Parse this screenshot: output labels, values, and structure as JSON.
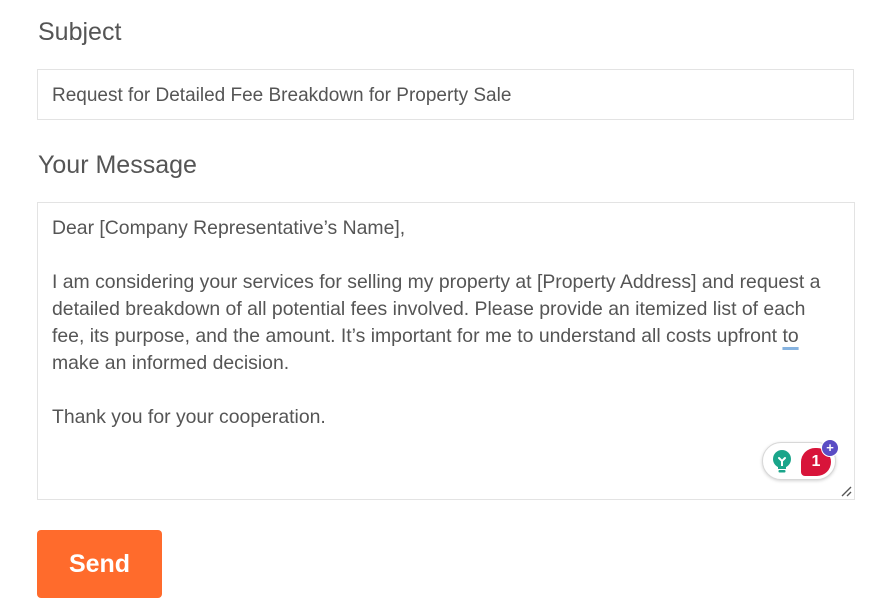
{
  "form": {
    "subject_label": "Subject",
    "subject_value": "Request for Detailed Fee Breakdown for Property Sale",
    "message_label": "Your Message",
    "message": {
      "greeting": "Dear [Company Representative’s Name],",
      "body_before_underline": "I am considering your services for selling my property at [Property Address] and request a detailed breakdown of all potential fees involved. Please provide an itemized list of each fee, its purpose, and the amount. It’s important for me to understand all costs upfront ",
      "body_underlined_word": "to",
      "body_after_underline": " make an informed decision.",
      "closing": "Thank you for your cooperation."
    },
    "send_label": "Send"
  },
  "grammarly": {
    "alert_count": "1",
    "plus_symbol": "+",
    "icons": [
      "lightbulb-icon",
      "plus-icon"
    ],
    "colors": {
      "bulb": "#1aa58a",
      "alert": "#d8143a",
      "plus": "#5a4cc4"
    }
  },
  "colors": {
    "send_button": "#ff6b2c",
    "text": "#555555",
    "border": "#e3e3e3"
  }
}
